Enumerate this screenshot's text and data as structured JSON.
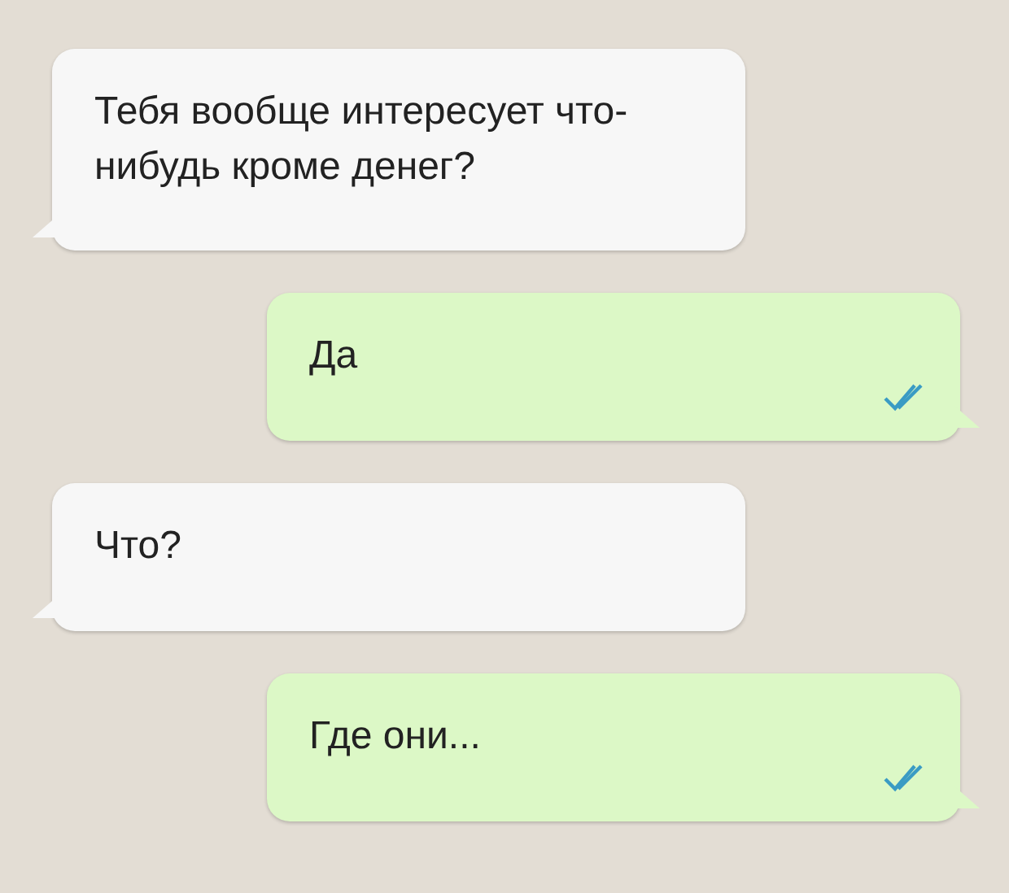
{
  "messages": [
    {
      "kind": "incoming",
      "text": "Тебя вообще интересует что-нибудь кроме денег?"
    },
    {
      "kind": "outgoing",
      "text": "Да",
      "read": true
    },
    {
      "kind": "incoming",
      "text": "Что?"
    },
    {
      "kind": "outgoing",
      "text": "Где они...",
      "read": true
    }
  ]
}
